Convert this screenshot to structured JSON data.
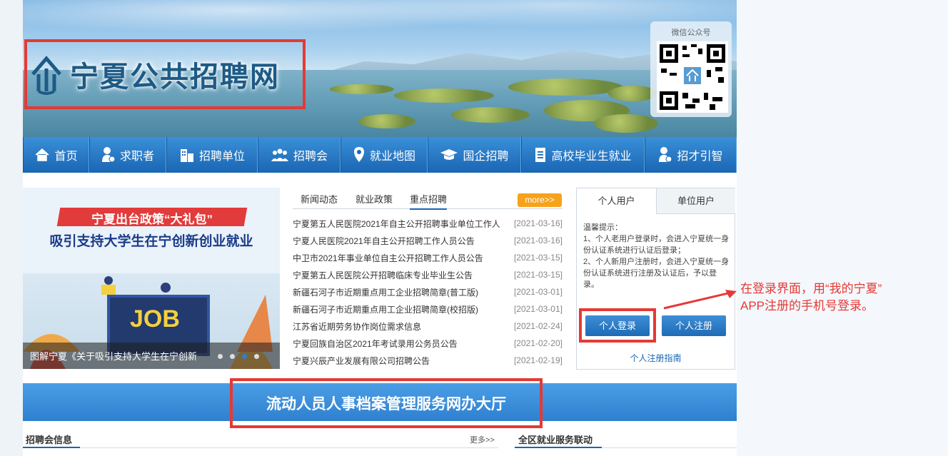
{
  "site": {
    "title": "宁夏公共招聘网"
  },
  "wechat": {
    "label": "微信公众号"
  },
  "nav": {
    "items": [
      {
        "label": "首页",
        "icon": "home-icon"
      },
      {
        "label": "求职者",
        "icon": "jobseeker-icon"
      },
      {
        "label": "招聘单位",
        "icon": "company-icon"
      },
      {
        "label": "招聘会",
        "icon": "job-fair-icon"
      },
      {
        "label": "就业地图",
        "icon": "map-pin-icon"
      },
      {
        "label": "国企招聘",
        "icon": "graduation-cap-icon"
      },
      {
        "label": "高校毕业生就业",
        "icon": "document-icon"
      },
      {
        "label": "招才引智",
        "icon": "talent-icon"
      }
    ]
  },
  "slider": {
    "headline": "宁夏出台政策“大礼包”",
    "subline": "吸引支持大学生在宁创新创业就业",
    "board_text": "JOB",
    "caption": "图解宁夏《关于吸引支持大学生在宁创新",
    "dot_count": 4,
    "active_dot": 3
  },
  "news": {
    "tabs": [
      "新闻动态",
      "就业政策",
      "重点招聘"
    ],
    "active_tab": 2,
    "more_label": "more>>",
    "items": [
      {
        "title": "宁夏第五人民医院2021年自主公开招聘事业单位工作人",
        "date": "[2021-03-16]"
      },
      {
        "title": "宁夏人民医院2021年自主公开招聘工作人员公告",
        "date": "[2021-03-16]"
      },
      {
        "title": "中卫市2021年事业单位自主公开招聘工作人员公告",
        "date": "[2021-03-15]"
      },
      {
        "title": "宁夏第五人民医院公开招聘临床专业毕业生公告",
        "date": "[2021-03-15]"
      },
      {
        "title": "新疆石河子市近期重点用工企业招聘简章(普工版)",
        "date": "[2021-03-01]"
      },
      {
        "title": "新疆石河子市近期重点用工企业招聘简章(校招版)",
        "date": "[2021-03-01]"
      },
      {
        "title": "江苏省近期劳务协作岗位需求信息",
        "date": "[2021-02-24]"
      },
      {
        "title": "宁夏回族自治区2021年考试录用公务员公告",
        "date": "[2021-02-20]"
      },
      {
        "title": "宁夏兴辰产业发展有限公司招聘公告",
        "date": "[2021-02-19]"
      }
    ]
  },
  "login": {
    "tab_personal": "个人用户",
    "tab_company": "单位用户",
    "tips_title": "温馨提示：",
    "tip1": "1、个人老用户登录时，会进入宁夏统一身份认证系统进行认证后登录；",
    "tip2": "2、个人新用户注册时，会进入宁夏统一身份认证系统进行注册及认证后，予以登录。",
    "login_button": "个人登录",
    "register_button": "个人注册",
    "guide_link": "个人注册指南"
  },
  "annotation": {
    "line1": "在登录界面，用“我的宁夏”",
    "line2": "APP注册的手机号登录。"
  },
  "archive": {
    "label": "流动人员人事档案管理服务网办大厅"
  },
  "sections": {
    "left_title": "招聘会信息",
    "left_more": "更多>>",
    "right_title": "全区就业服务联动"
  },
  "colors": {
    "nav_blue": "#1a66b4",
    "highlight_red": "#e53935",
    "more_orange": "#f7a21b"
  }
}
